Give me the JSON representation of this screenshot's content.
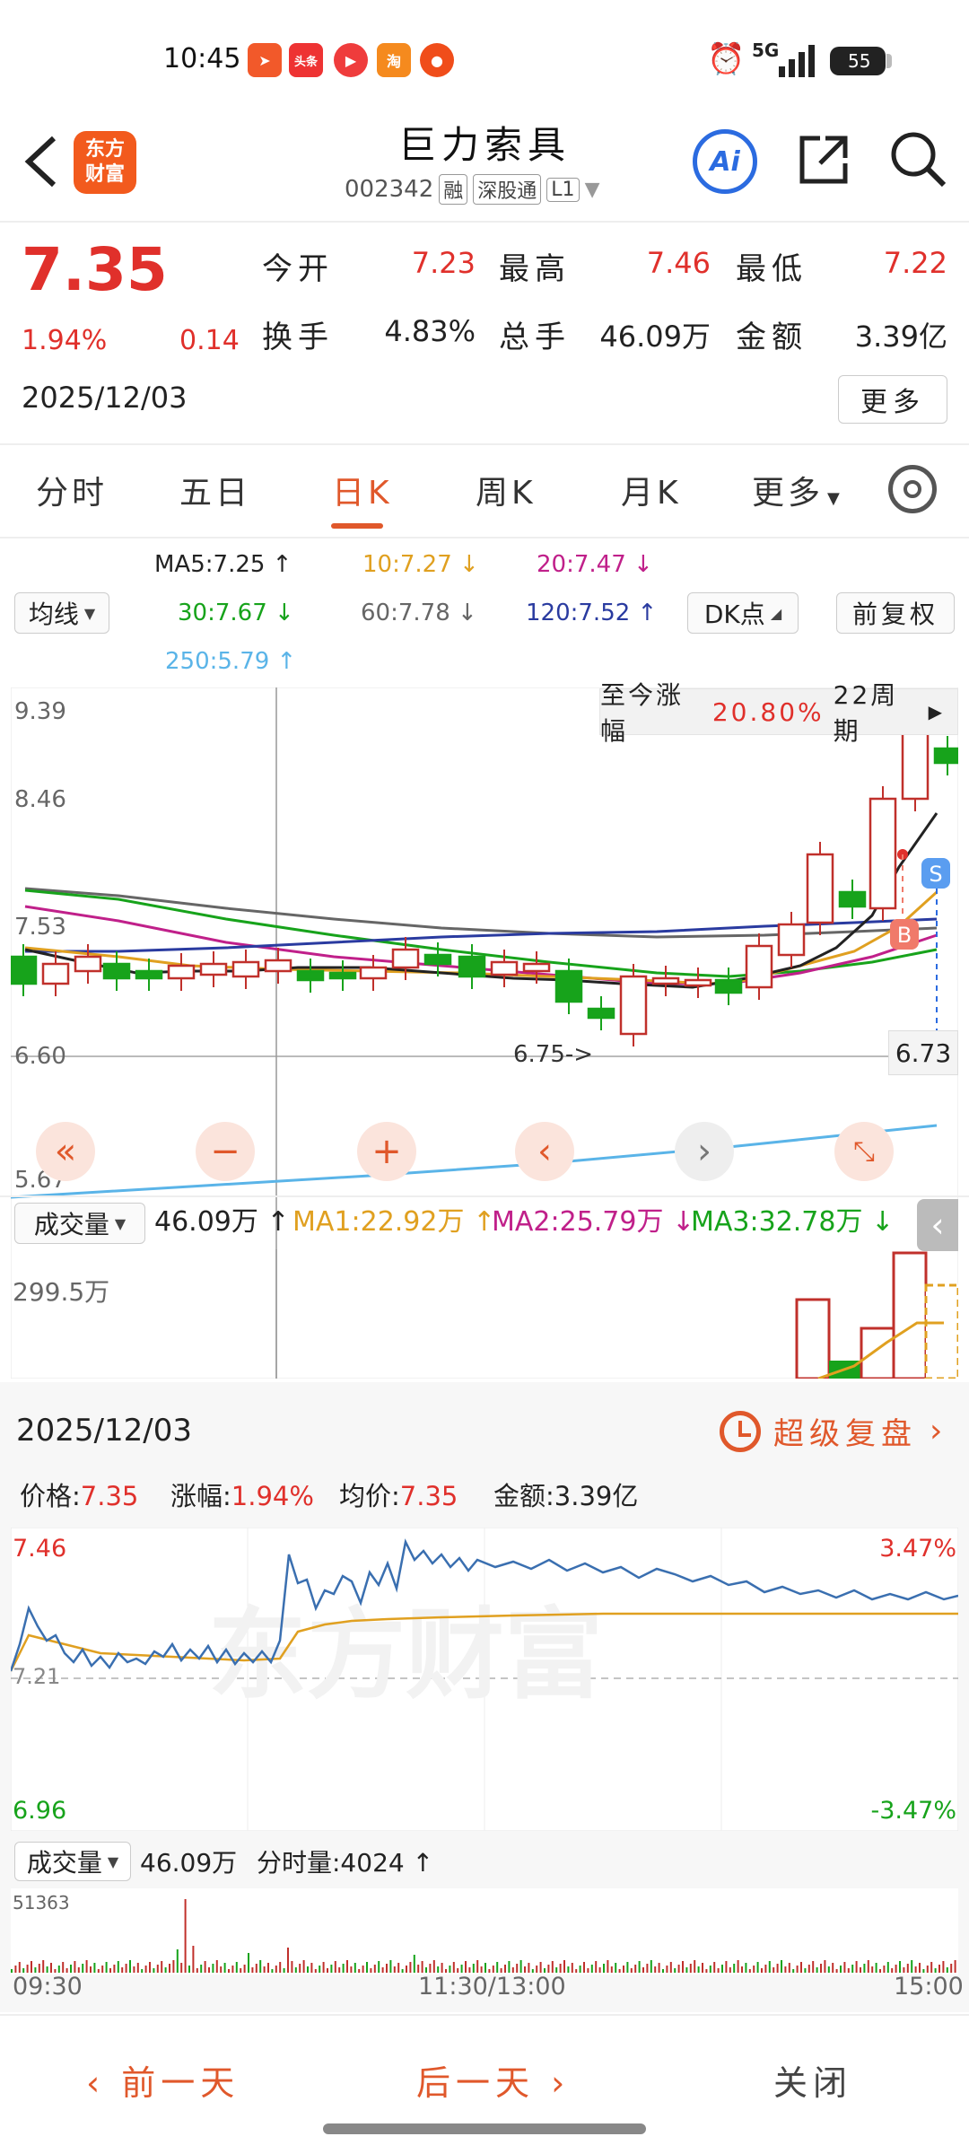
{
  "status_bar": {
    "time": "10:45",
    "apps": [
      "飞书",
      "头条",
      "视频",
      "淘",
      "外卖"
    ],
    "battery": "55",
    "network": "5G"
  },
  "header": {
    "back_icon": "chevron-left-icon",
    "logo_line1": "东方",
    "logo_line2": "财富",
    "stock_name": "巨力索具",
    "stock_code": "002342",
    "tags": [
      "融",
      "深股通",
      "L1"
    ],
    "ai_label": "Ai"
  },
  "quote": {
    "price": "7.35",
    "change_pct": "1.94%",
    "change": "0.14",
    "date": "2025/12/03",
    "fields": [
      {
        "label": "今开",
        "value": "7.23"
      },
      {
        "label": "最高",
        "value": "7.46"
      },
      {
        "label": "最低",
        "value": "7.22"
      },
      {
        "label": "换手",
        "value": "4.83%"
      },
      {
        "label": "总手",
        "value": "46.09万"
      },
      {
        "label": "金额",
        "value": "3.39亿"
      }
    ],
    "more": "更多"
  },
  "tabs": [
    {
      "label": "分时"
    },
    {
      "label": "五日"
    },
    {
      "label": "日K"
    },
    {
      "label": "周K"
    },
    {
      "label": "月K"
    },
    {
      "label": "更多"
    }
  ],
  "ma": {
    "selector": "均线",
    "ma5": "MA5:7.25 ↑",
    "ma10": "10:7.27 ↓",
    "ma20": "20:7.47 ↓",
    "ma30": "30:7.67 ↓",
    "ma60": "60:7.78 ↓",
    "ma120": "120:7.52 ↑",
    "ma250": "250:5.79 ↑",
    "dk": "DK点",
    "adjust": "前复权"
  },
  "kline": {
    "gain_label": "至今涨幅",
    "gain_value": "20.80%",
    "period": "22周期",
    "y_labels": [
      "9.39",
      "8.46",
      "7.53",
      "6.60",
      "5.67"
    ],
    "low_marker": "6.75->",
    "price_tag": "6.73",
    "markers": {
      "sell": "S",
      "buy": "B"
    }
  },
  "volume": {
    "selector": "成交量",
    "total": "46.09万 ↑",
    "ma1": "MA1:22.92万 ↑",
    "ma2": "MA2:25.79万 ↓",
    "ma3": "MA3:32.78万 ↓",
    "max_label": "299.5万"
  },
  "panel": {
    "date": "2025/12/03",
    "replay": "超级复盘",
    "price_label": "价格:",
    "price": "7.35",
    "chg_label": "涨幅:",
    "chg": "1.94%",
    "avg_label": "均价:",
    "avg": "7.35",
    "amt_label": "金额:",
    "amt": "3.39亿",
    "y_top": "7.46",
    "y_mid": "7.21",
    "y_bot": "6.96",
    "pct_top": "3.47%",
    "pct_bot": "-3.47%",
    "vol_selector": "成交量",
    "vol_total": "46.09万",
    "vol_tick": "分时量:4024 ↑",
    "vol_max": "51363",
    "times": [
      "09:30",
      "11:30/13:00",
      "15:00"
    ]
  },
  "nav": {
    "prev": "前一天",
    "next": "后一天",
    "close": "关闭"
  }
}
